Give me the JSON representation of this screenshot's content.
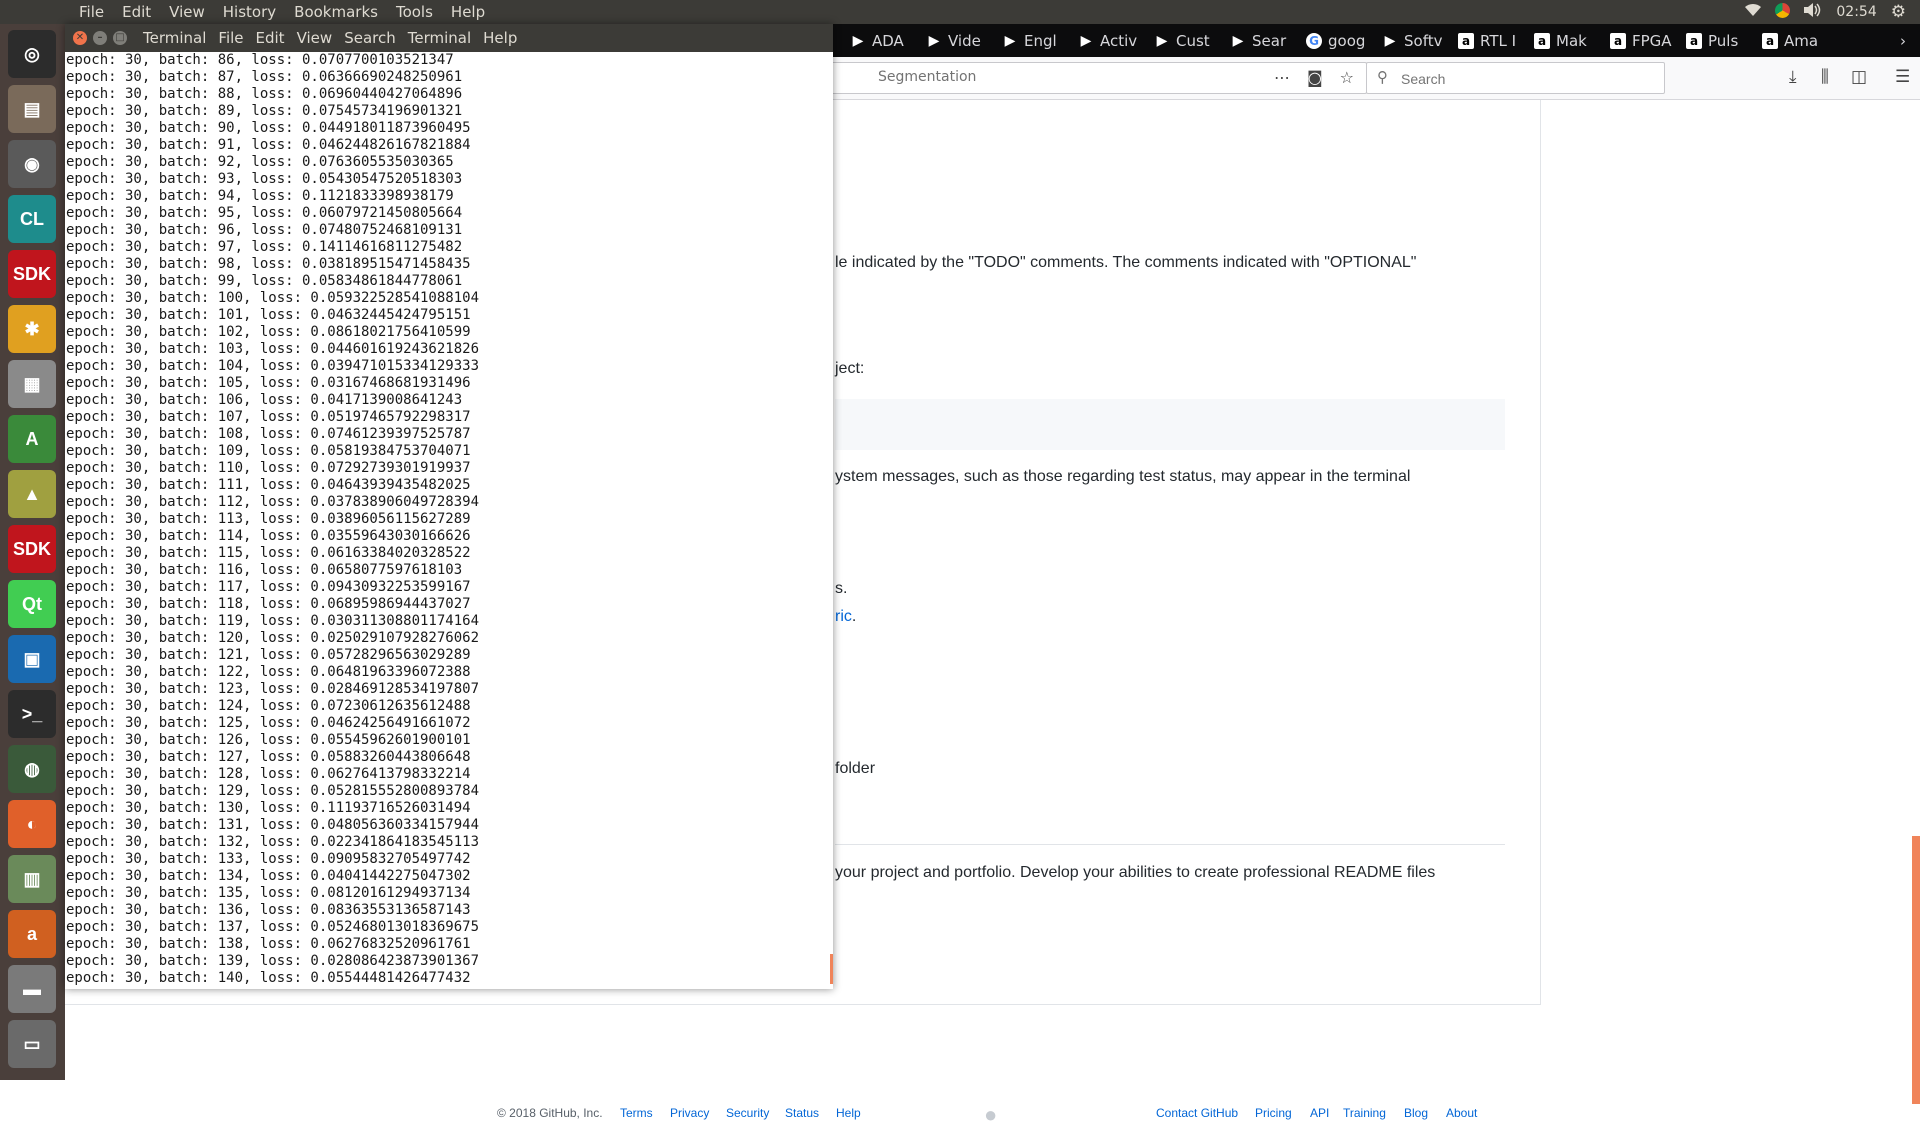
{
  "top_panel": {
    "menus": [
      "File",
      "Edit",
      "View",
      "History",
      "Bookmarks",
      "Tools",
      "Help"
    ],
    "clock": "02:54",
    "tray_icons": [
      "wifi-icon",
      "chrome-icon",
      "volume-icon",
      "gear-icon"
    ]
  },
  "launcher": {
    "items": [
      {
        "name": "ubuntu-dash-icon",
        "glyph": "◎",
        "color": "#2c2c2c"
      },
      {
        "name": "files-icon",
        "glyph": "▤",
        "color": "#7a6a5a"
      },
      {
        "name": "camera-icon",
        "glyph": "◉",
        "color": "#5a5a5a"
      },
      {
        "name": "clion-icon",
        "glyph": "CL",
        "color": "#1e8c8c"
      },
      {
        "name": "sdk-icon",
        "glyph": "SDK",
        "color": "#c0151d"
      },
      {
        "name": "slack-icon",
        "glyph": "✱",
        "color": "#e0a020"
      },
      {
        "name": "cube-icon",
        "glyph": "▦",
        "color": "#8a8a8a"
      },
      {
        "name": "android-studio-icon",
        "glyph": "A",
        "color": "#3a8a3a"
      },
      {
        "name": "vivado-icon",
        "glyph": "▲",
        "color": "#a0a040"
      },
      {
        "name": "sdk-icon-2",
        "glyph": "SDK",
        "color": "#c0151d"
      },
      {
        "name": "qt-icon",
        "glyph": "Qt",
        "color": "#41cd52"
      },
      {
        "name": "virtualbox-icon",
        "glyph": "▣",
        "color": "#1a6ab0"
      },
      {
        "name": "terminal-icon",
        "glyph": ">_",
        "color": "#2c2c2c"
      },
      {
        "name": "camera-lens-icon",
        "glyph": "◍",
        "color": "#3a5a3a"
      },
      {
        "name": "firefox-icon",
        "glyph": "◐",
        "color": "#e0602a"
      },
      {
        "name": "libreoffice-icon",
        "glyph": "▥",
        "color": "#6a8a5a"
      },
      {
        "name": "amazon-icon",
        "glyph": "a",
        "color": "#d06020"
      },
      {
        "name": "software-center-icon",
        "glyph": "▬",
        "color": "#7a7a7a"
      },
      {
        "name": "trash-icon",
        "glyph": "▭",
        "color": "#6a6a6a"
      }
    ]
  },
  "firefox": {
    "tabs": [
      {
        "label": "ADA",
        "icon": "play"
      },
      {
        "label": "Vide",
        "icon": "play"
      },
      {
        "label": "Engl",
        "icon": "play"
      },
      {
        "label": "Activ",
        "icon": "play"
      },
      {
        "label": "Cust",
        "icon": "play"
      },
      {
        "label": "Sear",
        "icon": "play"
      },
      {
        "label": "goog",
        "icon": "google"
      },
      {
        "label": "Softv",
        "icon": "play"
      },
      {
        "label": "RTL I",
        "icon": "amazon"
      },
      {
        "label": "Mak",
        "icon": "amazon"
      },
      {
        "label": "FPGA",
        "icon": "amazon"
      },
      {
        "label": "Puls",
        "icon": "amazon"
      },
      {
        "label": "Ama",
        "icon": "amazon"
      }
    ],
    "url_visible": "Segmentation",
    "search_placeholder": "Search",
    "content_fragments": [
      {
        "text": "le indicated by the \"TODO\" comments. The comments indicated with \"OPTIONAL\"",
        "link": false
      },
      {
        "text": "ject:",
        "link": false
      },
      {
        "text": "ystem messages, such as those regarding test status, may appear in the terminal",
        "link": false
      },
      {
        "text": "s.",
        "link": false
      },
      {
        "text": "ric",
        "link": true
      },
      {
        "text": "folder",
        "link": false
      },
      {
        "text": "your project and portfolio. Develop your abilities to create professional README files",
        "link": false
      }
    ],
    "footer": {
      "copyright": "© 2018 GitHub, Inc.",
      "links_left": [
        "Terms",
        "Privacy",
        "Security",
        "Status",
        "Help"
      ],
      "links_right": [
        "Contact GitHub",
        "Pricing",
        "API",
        "Training",
        "Blog",
        "About"
      ]
    }
  },
  "terminal": {
    "title_menus": [
      "Terminal",
      "File",
      "Edit",
      "View",
      "Search",
      "Terminal",
      "Help"
    ],
    "lines": [
      "epoch: 30, batch: 86, loss: 0.0707700103521347",
      "epoch: 30, batch: 87, loss: 0.06366690248250961",
      "epoch: 30, batch: 88, loss: 0.06960440427064896",
      "epoch: 30, batch: 89, loss: 0.07545734196901321",
      "epoch: 30, batch: 90, loss: 0.044918011873960495",
      "epoch: 30, batch: 91, loss: 0.046244826167821884",
      "epoch: 30, batch: 92, loss: 0.0763605535030365",
      "epoch: 30, batch: 93, loss: 0.05430547520518303",
      "epoch: 30, batch: 94, loss: 0.1121833398938179",
      "epoch: 30, batch: 95, loss: 0.06079721450805664",
      "epoch: 30, batch: 96, loss: 0.07480752468109131",
      "epoch: 30, batch: 97, loss: 0.14114616811275482",
      "epoch: 30, batch: 98, loss: 0.038189515471458435",
      "epoch: 30, batch: 99, loss: 0.05834861844778061",
      "epoch: 30, batch: 100, loss: 0.059322528541088104",
      "epoch: 30, batch: 101, loss: 0.04632445424795151",
      "epoch: 30, batch: 102, loss: 0.08618021756410599",
      "epoch: 30, batch: 103, loss: 0.044601619243621826",
      "epoch: 30, batch: 104, loss: 0.039471015334129333",
      "epoch: 30, batch: 105, loss: 0.03167468681931496",
      "epoch: 30, batch: 106, loss: 0.0417139008641243",
      "epoch: 30, batch: 107, loss: 0.05197465792298317",
      "epoch: 30, batch: 108, loss: 0.07461239397525787",
      "epoch: 30, batch: 109, loss: 0.05819384753704071",
      "epoch: 30, batch: 110, loss: 0.07292739301919937",
      "epoch: 30, batch: 111, loss: 0.04643939435482025",
      "epoch: 30, batch: 112, loss: 0.037838906049728394",
      "epoch: 30, batch: 113, loss: 0.03896056115627289",
      "epoch: 30, batch: 114, loss: 0.03559643030166626",
      "epoch: 30, batch: 115, loss: 0.06163384020328522",
      "epoch: 30, batch: 116, loss: 0.0658077597618103",
      "epoch: 30, batch: 117, loss: 0.09430932253599167",
      "epoch: 30, batch: 118, loss: 0.06895986944437027",
      "epoch: 30, batch: 119, loss: 0.030311308801174164",
      "epoch: 30, batch: 120, loss: 0.025029107928276062",
      "epoch: 30, batch: 121, loss: 0.05728296563029289",
      "epoch: 30, batch: 122, loss: 0.06481963396072388",
      "epoch: 30, batch: 123, loss: 0.028469128534197807",
      "epoch: 30, batch: 124, loss: 0.07230612635612488",
      "epoch: 30, batch: 125, loss: 0.04624256491661072",
      "epoch: 30, batch: 126, loss: 0.05545962601900101",
      "epoch: 30, batch: 127, loss: 0.05883260443806648",
      "epoch: 30, batch: 128, loss: 0.06276413798332214",
      "epoch: 30, batch: 129, loss: 0.052815552800893784",
      "epoch: 30, batch: 130, loss: 0.11193716526031494",
      "epoch: 30, batch: 131, loss: 0.048056360334157944",
      "epoch: 30, batch: 132, loss: 0.022341864183545113",
      "epoch: 30, batch: 133, loss: 0.09095832705497742",
      "epoch: 30, batch: 134, loss: 0.04041442275047302",
      "epoch: 30, batch: 135, loss: 0.08120161294937134",
      "epoch: 30, batch: 136, loss: 0.08363553136587143",
      "epoch: 30, batch: 137, loss: 0.052468013018369675",
      "epoch: 30, batch: 138, loss: 0.06276832520961761",
      "epoch: 30, batch: 139, loss: 0.028086423873901367",
      "epoch: 30, batch: 140, loss: 0.05544481426477432"
    ]
  }
}
